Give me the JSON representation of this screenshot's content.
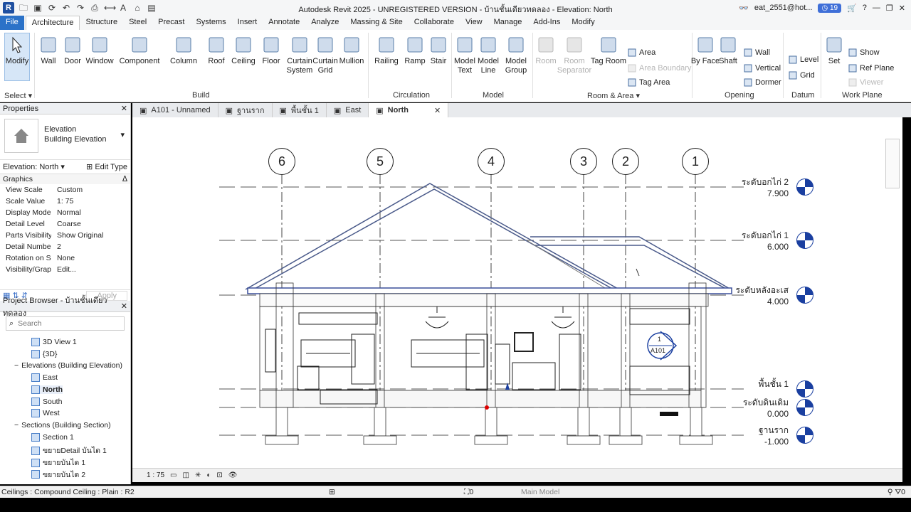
{
  "window": {
    "title": "Autodesk Revit 2025 - UNREGISTERED VERSION - บ้านชั้นเดียวทดลอง - Elevation: North",
    "user": "eat_2551@hot...",
    "notifications": "19"
  },
  "tabs": [
    "File",
    "Architecture",
    "Structure",
    "Steel",
    "Precast",
    "Systems",
    "Insert",
    "Annotate",
    "Analyze",
    "Massing & Site",
    "Collaborate",
    "View",
    "Manage",
    "Add-Ins",
    "Modify"
  ],
  "ribbon": {
    "select": {
      "label": "Modify",
      "panel": "Select"
    },
    "build": {
      "panel": "Build",
      "buttons": [
        "Wall",
        "Door",
        "Window",
        "Component",
        "Column",
        "Roof",
        "Ceiling",
        "Floor",
        "Curtain System",
        "Curtain Grid",
        "Mullion"
      ]
    },
    "circulation": {
      "panel": "Circulation",
      "buttons": [
        "Railing",
        "Ramp",
        "Stair"
      ]
    },
    "model": {
      "panel": "Model",
      "buttons": [
        "Model Text",
        "Model Line",
        "Model Group"
      ]
    },
    "room": {
      "panel": "Room & Area",
      "buttons": [
        "Room",
        "Room Separator",
        "Tag Room"
      ],
      "small": [
        "Area",
        "Area Boundary",
        "Tag Area"
      ]
    },
    "opening": {
      "panel": "Opening",
      "buttons": [
        "By Face",
        "Shaft"
      ],
      "small": [
        "Wall",
        "Vertical",
        "Dormer"
      ]
    },
    "datum": {
      "panel": "Datum",
      "small": [
        "Level",
        "Grid"
      ]
    },
    "workplane": {
      "panel": "Work Plane",
      "buttons": [
        "Set"
      ],
      "small": [
        "Show",
        "Ref Plane",
        "Viewer"
      ]
    }
  },
  "properties": {
    "title": "Properties",
    "type_line1": "Elevation",
    "type_line2": "Building Elevation",
    "selector": "Elevation: North",
    "edit_type": "Edit Type",
    "section": "Graphics",
    "rows": [
      {
        "k": "View Scale",
        "v": "Custom"
      },
      {
        "k": "Scale Value",
        "v": "1:  75"
      },
      {
        "k": "Display Model",
        "v": "Normal"
      },
      {
        "k": "Detail Level",
        "v": "Coarse"
      },
      {
        "k": "Parts Visibility",
        "v": "Show Original"
      },
      {
        "k": "Detail Number",
        "v": "2"
      },
      {
        "k": "Rotation on S...",
        "v": "None"
      },
      {
        "k": "Visibility/Grap...",
        "v": "Edit..."
      }
    ],
    "apply": "Apply"
  },
  "browser": {
    "title": "Project Browser - บ้านชั้นเดียวทดลอง",
    "search_placeholder": "Search",
    "items": [
      {
        "label": "3D View 1",
        "indent": 3,
        "icon": true
      },
      {
        "label": "{3D}",
        "indent": 3,
        "icon": true
      },
      {
        "label": "Elevations (Building Elevation)",
        "indent": 1,
        "icon": false
      },
      {
        "label": "East",
        "indent": 3,
        "icon": true
      },
      {
        "label": "North",
        "indent": 3,
        "icon": true,
        "bold": true
      },
      {
        "label": "South",
        "indent": 3,
        "icon": true
      },
      {
        "label": "West",
        "indent": 3,
        "icon": true
      },
      {
        "label": "Sections (Building Section)",
        "indent": 1,
        "icon": false
      },
      {
        "label": "Section 1",
        "indent": 3,
        "icon": true
      },
      {
        "label": "ขยายDetail บันได 1",
        "indent": 3,
        "icon": true
      },
      {
        "label": "ขยายบันได 1",
        "indent": 3,
        "icon": true
      },
      {
        "label": "ขยายบันได 2",
        "indent": 3,
        "icon": true
      }
    ]
  },
  "view_tabs": [
    {
      "label": "A101 - Unnamed",
      "active": false
    },
    {
      "label": "ฐานราก",
      "active": false
    },
    {
      "label": "พื้นชั้น 1",
      "active": false
    },
    {
      "label": "East",
      "active": false
    },
    {
      "label": "North",
      "active": true
    }
  ],
  "grids": [
    "6",
    "5",
    "4",
    "3",
    "2",
    "1"
  ],
  "levels": [
    {
      "name": "ระดับอกไก่ 2",
      "value": "7.900"
    },
    {
      "name": "ระดับอกไก่ 1",
      "value": "6.000"
    },
    {
      "name": "ระดับหลังอะเส",
      "value": "4.000"
    },
    {
      "name": "พื้นชั้น 1",
      "value": ""
    },
    {
      "name": "ระดับดินเดิม",
      "value": "0.000"
    },
    {
      "name": "ฐานราก",
      "value": "-1.000"
    }
  ],
  "section_tag": {
    "top": "1",
    "bottom": "A101"
  },
  "view_control": {
    "scale": "1 : 75"
  },
  "status": {
    "text": "Ceilings : Compound Ceiling : Plain : R2",
    "model": "Main Model",
    "count": "0",
    "filter": "0"
  }
}
